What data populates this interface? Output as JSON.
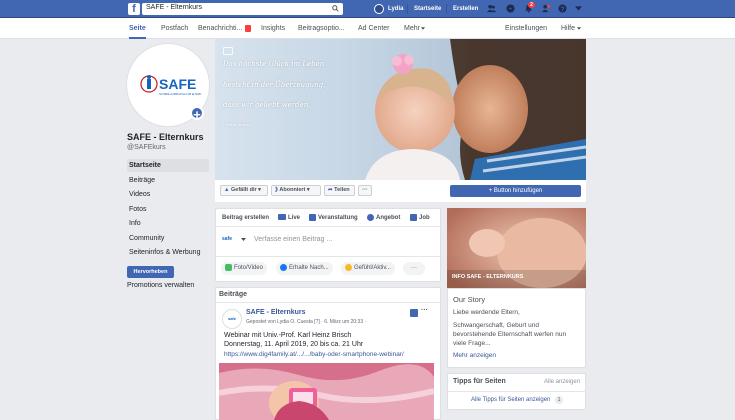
{
  "topbar": {
    "search_value": "SAFE - Elternkurs",
    "user_name": "Lydia",
    "nav_home": "Startseite",
    "nav_create": "Erstellen",
    "notification_badge": "2"
  },
  "page_tabs": [
    {
      "label": "Seite"
    },
    {
      "label": "Postfach"
    },
    {
      "label": "Benachrichti..."
    },
    {
      "label": "Insights"
    },
    {
      "label": "Beitragsoptio..."
    },
    {
      "label": "Ad Center"
    },
    {
      "label": "Mehr"
    },
    {
      "label": "Einstellungen"
    },
    {
      "label": "Hilfe"
    }
  ],
  "page": {
    "name": "SAFE - Elternkurs",
    "handle": "@SAFEkurs",
    "logo_text": "SAFE",
    "logo_subtext": "SICHERE AUSBILDUNG FÜR ELTERN"
  },
  "left_nav": [
    {
      "label": "Startseite"
    },
    {
      "label": "Beiträge"
    },
    {
      "label": "Videos"
    },
    {
      "label": "Fotos"
    },
    {
      "label": "Info"
    },
    {
      "label": "Community"
    },
    {
      "label": "Seiteninfos & Werbung"
    }
  ],
  "promote": {
    "button": "Hervorheben",
    "link": "Promotions verwalten"
  },
  "cover": {
    "line1": "Das höchste Glück im Leben",
    "line2": "besteht in der Überzeugung,",
    "line3": "dass wir geliebt werden.",
    "author": "(Victor Hugo)"
  },
  "actions": {
    "like": "Gefällt dir",
    "follow": "Abonniert",
    "share": "Teilen",
    "more": "···",
    "add_button": "+ Button hinzufügen"
  },
  "composer": {
    "tabs": [
      "Beitrag erstellen",
      "Live",
      "Veranstaltung",
      "Angebot",
      "Job"
    ],
    "placeholder": "Verfasse einen Beitrag ...",
    "actions": [
      "Foto/Video",
      "Erhalte Nach...",
      "Gefühl/Aktiv..."
    ],
    "more": "···",
    "author_badge": "safe"
  },
  "posts_section": {
    "title": "Beiträge"
  },
  "post": {
    "author": "SAFE - Elternkurs",
    "meta": "Gepostet von Lydia O. Cuesta [?] · 6. März um 20:33 · ",
    "line1": "Webinar mit Univ.-Prof. Karl Heinz Brisch",
    "line2": "Donnerstag, 11. April 2019, 20 bis ca. 21 Uhr",
    "link": "https://www.dig4family.at/.../.../baby-oder-smartphone-webinar/",
    "more": "···"
  },
  "sidebar": {
    "photo_caption": "INFO SAFE - ELTERNKURS",
    "story_title": "Our Story",
    "story_text1": "Liebe werdende Eltern,",
    "story_text2": "Schwangerschaft, Geburt und",
    "story_text3": "bevorstehende Elternschaft werfen nun",
    "story_text4": "viele Frage...",
    "story_more": "Mehr anzeigen",
    "tips_title": "Tipps für Seiten",
    "tips_all": "Alle anzeigen",
    "tips_link": "Alle Tipps für Seiten anzeigen",
    "tips_count": "1"
  },
  "colors": {
    "brand": "#4267b2",
    "link": "#385898",
    "background": "#e9ebee"
  }
}
